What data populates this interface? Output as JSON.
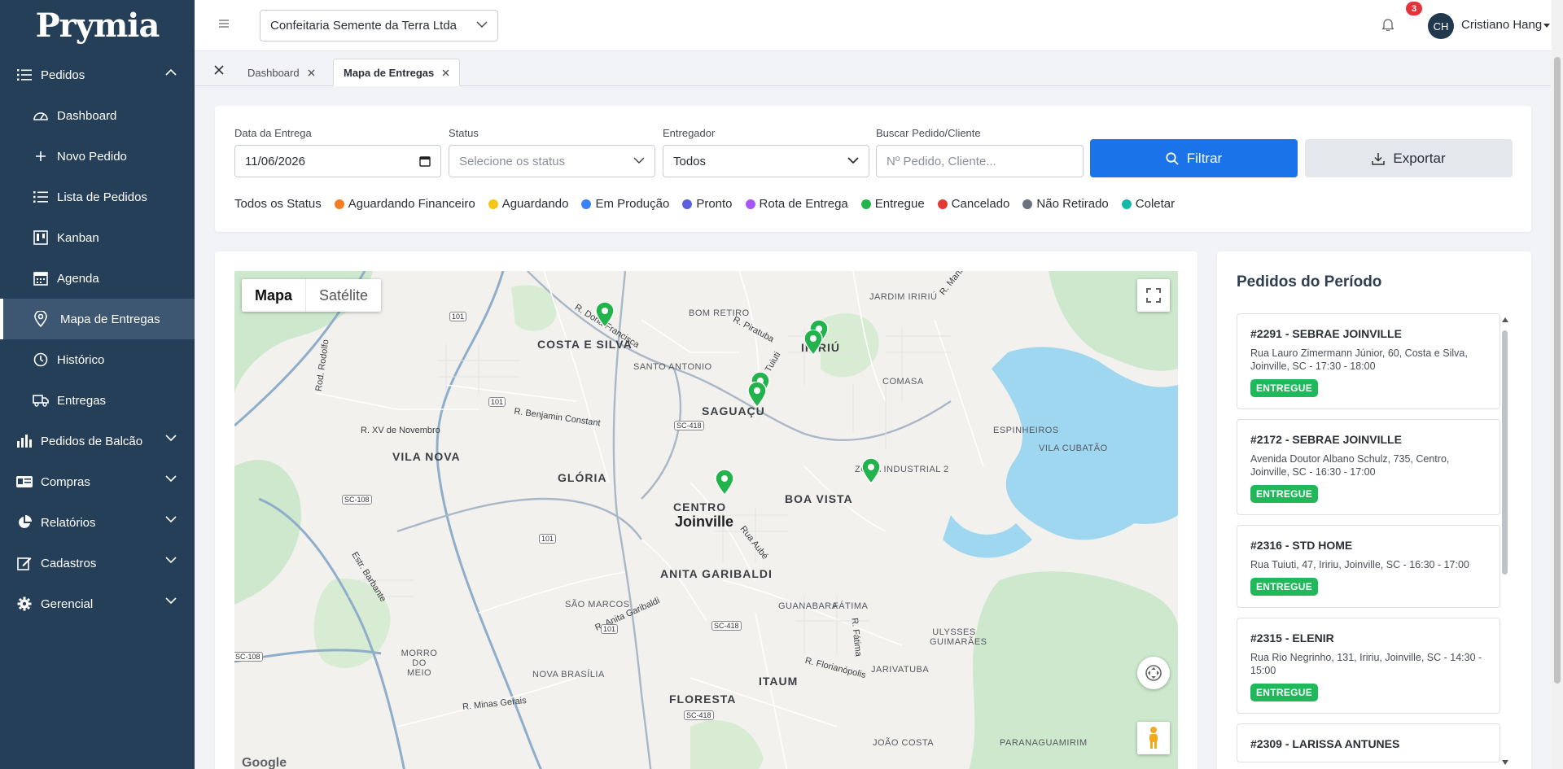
{
  "app": {
    "logo": "Prymia"
  },
  "sidebar": {
    "items": [
      {
        "label": "Pedidos",
        "icon": "list-icon",
        "expanded": true
      },
      {
        "label": "Dashboard",
        "icon": "gauge-icon"
      },
      {
        "label": "Novo Pedido",
        "icon": "plus-icon"
      },
      {
        "label": "Lista de Pedidos",
        "icon": "list-icon"
      },
      {
        "label": "Kanban",
        "icon": "kanban-icon"
      },
      {
        "label": "Agenda",
        "icon": "calendar-icon"
      },
      {
        "label": "Mapa de Entregas",
        "icon": "map-pin-icon",
        "active": true
      },
      {
        "label": "Histórico",
        "icon": "clock-icon"
      },
      {
        "label": "Entregas",
        "icon": "truck-icon"
      },
      {
        "label": "Pedidos de Balcão",
        "icon": "bar-chart-icon"
      },
      {
        "label": "Compras",
        "icon": "id-card-icon"
      },
      {
        "label": "Relatórios",
        "icon": "chart-pie-icon"
      },
      {
        "label": "Cadastros",
        "icon": "edit-icon"
      },
      {
        "label": "Gerencial",
        "icon": "gear-icon"
      }
    ]
  },
  "topbar": {
    "company": "Confeitaria Semente da Terra Ltda",
    "notifications": "3",
    "avatar": "CH",
    "user": "Cristiano Hang"
  },
  "tabs": [
    {
      "label": "Dashboard"
    },
    {
      "label": "Mapa de Entregas",
      "active": true
    }
  ],
  "filters": {
    "date_label": "Data da Entrega",
    "date_value": "11/06/2026",
    "status_label": "Status",
    "status_placeholder": "Selecione os status",
    "courier_label": "Entregador",
    "courier_value": "Todos",
    "search_label": "Buscar Pedido/Cliente",
    "search_placeholder": "Nº Pedido, Cliente...",
    "filter_button": "Filtrar",
    "export_button": "Exportar"
  },
  "legend": {
    "all_label": "Todos os Status",
    "items": [
      {
        "label": "Aguardando Financeiro",
        "color": "#f57c1f"
      },
      {
        "label": "Aguardando",
        "color": "#f5c518"
      },
      {
        "label": "Em Produção",
        "color": "#3b82f6"
      },
      {
        "label": "Pronto",
        "color": "#5b5fe0"
      },
      {
        "label": "Rota de Entrega",
        "color": "#a855f7"
      },
      {
        "label": "Entregue",
        "color": "#22b34c"
      },
      {
        "label": "Cancelado",
        "color": "#e53935"
      },
      {
        "label": "Não Retirado",
        "color": "#6b7280"
      },
      {
        "label": "Coletar",
        "color": "#14b8a6"
      }
    ]
  },
  "map": {
    "toggle": [
      "Mapa",
      "Satélite"
    ],
    "attribution": "Google",
    "labels": {
      "costa_e_silva": "COSTA E SILVA",
      "bom_retiro": "BOM RETIRO",
      "santo_antonio": "SANTO ANTONIO",
      "saguacu": "SAGUAÇU",
      "iririu": "IRIRIÚ",
      "jardim_iririu": "JARDIM IRIRIÚ",
      "comasa": "COMASA",
      "espinheiros": "ESPINHEIROS",
      "vila_cubatao": "VILA CUBATÃO",
      "vila_nova": "VILA NOVA",
      "gloria": "GLÓRIA",
      "centro": "CENTRO",
      "joinville": "Joinville",
      "boa_vista": "BOA VISTA",
      "zona_industrial": "ZONA INDUSTRIAL 2",
      "anita_garibaldi": "ANITA GARIBALDI",
      "sao_marcos": "SÃO MARCOS",
      "guanabara": "GUANABARA",
      "fatima": "FÁTIMA",
      "ulysses": "ULYSSES GUIMARÃES",
      "morro_do_meio": "MORRO DO MEIO",
      "nova_brasilia": "NOVA BRASÍLIA",
      "itaum": "ITAUM",
      "floresta": "FLORESTA",
      "jarivatuba": "JARIVATUBA",
      "joao_costa": "JOÃO COSTA",
      "paranaguamirim": "PARANAGUAMIRIM",
      "r_xv": "R. XV de Novembro",
      "r_benjamin": "R. Benjamin Constant",
      "r_dona_francisca": "R. Dona Francisca",
      "r_piratuba": "R. Piratuba",
      "rua_aube": "Rua Aubé",
      "r_anita": "R. Anita Garibaldi",
      "r_florianopolis": "R. Florianópolis",
      "r_minas": "R. Minas Gerais",
      "r_fatima": "R. Fátima",
      "estr_barbante": "Estr. Barbante",
      "rod_rodolfo": "Rod. Rodolfo",
      "r_martinho": "R. Martinho",
      "r_tuiuti": "R. Tuiuti"
    },
    "shields": [
      "101",
      "101",
      "101",
      "101",
      "SC-418",
      "SC-418",
      "SC-418",
      "SC-108",
      "SC-108"
    ]
  },
  "orders": {
    "title": "Pedidos do Período",
    "items": [
      {
        "title": "#2291 - SEBRAE JOINVILLE",
        "address": "Rua Lauro Zimermann Júnior, 60, Costa e Silva, Joinville, SC - 17:30 - 18:00",
        "status": "ENTREGUE"
      },
      {
        "title": "#2172 - SEBRAE JOINVILLE",
        "address": "Avenida Doutor Albano Schulz, 735, Centro, Joinville, SC - 16:30 - 17:00",
        "status": "ENTREGUE"
      },
      {
        "title": "#2316 - STD HOME",
        "address": "Rua Tuiuti, 47, Iririu, Joinville, SC - 16:30 - 17:00",
        "status": "ENTREGUE"
      },
      {
        "title": "#2315 - ELENIR",
        "address": "Rua Rio Negrinho, 131, Iririu, Joinville, SC - 14:30 - 15:00",
        "status": "ENTREGUE"
      },
      {
        "title": "#2309 - LARISSA ANTUNES",
        "address": "",
        "status": ""
      }
    ]
  }
}
